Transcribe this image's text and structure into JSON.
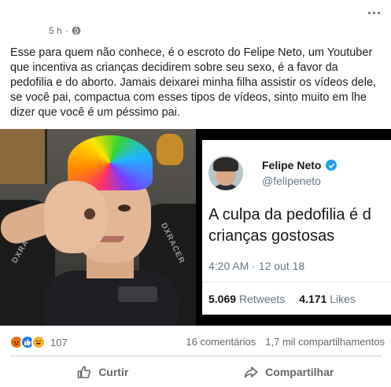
{
  "post": {
    "timestamp": "5 h",
    "privacy_icon": "globe-icon",
    "text": "Esse para quem não conhece, é o escroto do Felipe Neto, um Youtuber que incentiva as crianças decidirem sobre seu sexo, é a favor da pedofilia e do aborto. Jamais deixarei minha filha assistir os vídeos dele, se você pai, compactua com esses tipos de vídeos, sinto muito em lhe dizer que você é um péssimo pai."
  },
  "photo": {
    "brand_left": "DXRACER",
    "brand_right": "DXRACER"
  },
  "tweet": {
    "name": "Felipe Neto",
    "handle": "@felipeneto",
    "body_line1": "A culpa da pedofilia é d",
    "body_line2": "crianças gostosas",
    "time": "4:20 AM · 12 out 18",
    "retweets_count": "5.069",
    "retweets_label": "Retweets",
    "likes_count": "4.171",
    "likes_label": "Likes",
    "verified_color": "#1da1f2"
  },
  "reactions": {
    "icons": [
      "angry-icon",
      "like-icon",
      "haha-icon"
    ],
    "count": "107",
    "comments": "16 comentários",
    "shares": "1,7 mil compartilhamentos"
  },
  "actions": {
    "like_label": "Curtir",
    "share_label": "Compartilhar"
  },
  "colors": {
    "facebook_blue": "#1877f2",
    "muted_text": "#65676b"
  }
}
